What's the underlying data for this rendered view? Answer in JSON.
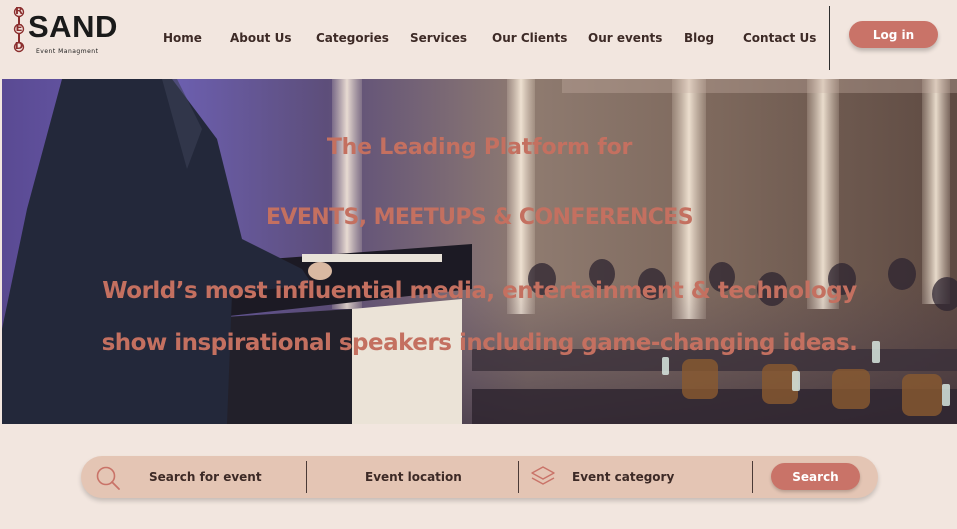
{
  "brand": {
    "vertical_letters": [
      "R",
      "E",
      "D"
    ],
    "name": "SAND",
    "tagline": "Event Managment"
  },
  "nav": {
    "items": [
      {
        "label": "Home"
      },
      {
        "label": "About Us"
      },
      {
        "label": "Categories"
      },
      {
        "label": "Services"
      },
      {
        "label": "Our Clients"
      },
      {
        "label": "Our events"
      },
      {
        "label": "Blog"
      },
      {
        "label": "Contact Us"
      }
    ],
    "login_label": "Log in"
  },
  "hero": {
    "line1": "The Leading Platform for",
    "line2": "EVENTS, MEETUPS & CONFERENCES",
    "line3": "World’s most influential media, entertainment & technology",
    "line4": "show inspirational speakers including game-changing ideas."
  },
  "search": {
    "event_placeholder": "Search for event",
    "location_placeholder": "Event location",
    "category_placeholder": "Event category",
    "button_label": "Search",
    "icons": [
      "search-icon",
      "category-layers-icon"
    ]
  },
  "colors": {
    "background": "#f2e6df",
    "accent": "#c97368",
    "hero_text": "#c47060",
    "search_bar": "#e4c5b4"
  }
}
